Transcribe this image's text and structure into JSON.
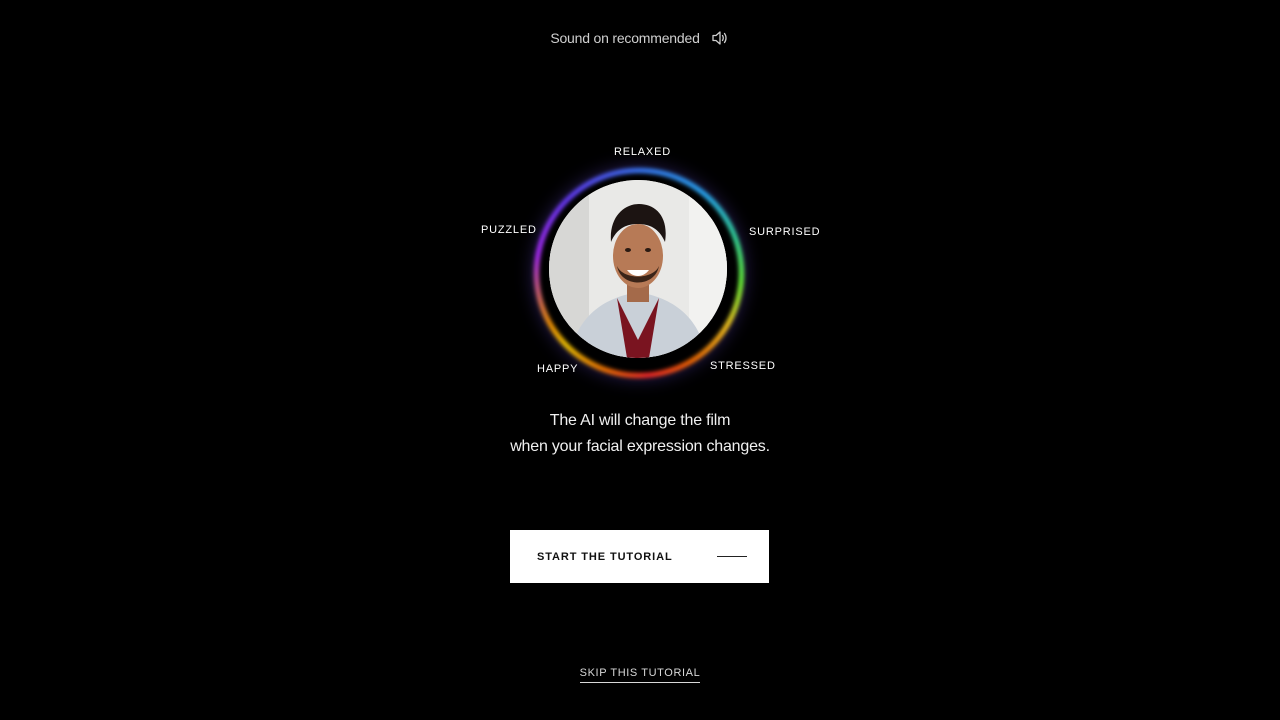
{
  "sound_hint": {
    "label": "Sound on recommended",
    "icon": "speaker-icon"
  },
  "emotions": {
    "relaxed": "RELAXED",
    "puzzled": "PUZZLED",
    "surprised": "SURPRISED",
    "happy": "HAPPY",
    "stressed": "STRESSED"
  },
  "caption": {
    "line1": "The AI will change the film",
    "line2": "when your facial expression changes."
  },
  "start_button": {
    "label": "START THE TUTORIAL"
  },
  "skip_link": {
    "label": "SKIP THIS TUTORIAL"
  },
  "colors": {
    "background": "#000000",
    "button_bg": "#ffffff",
    "button_text": "#111111"
  }
}
